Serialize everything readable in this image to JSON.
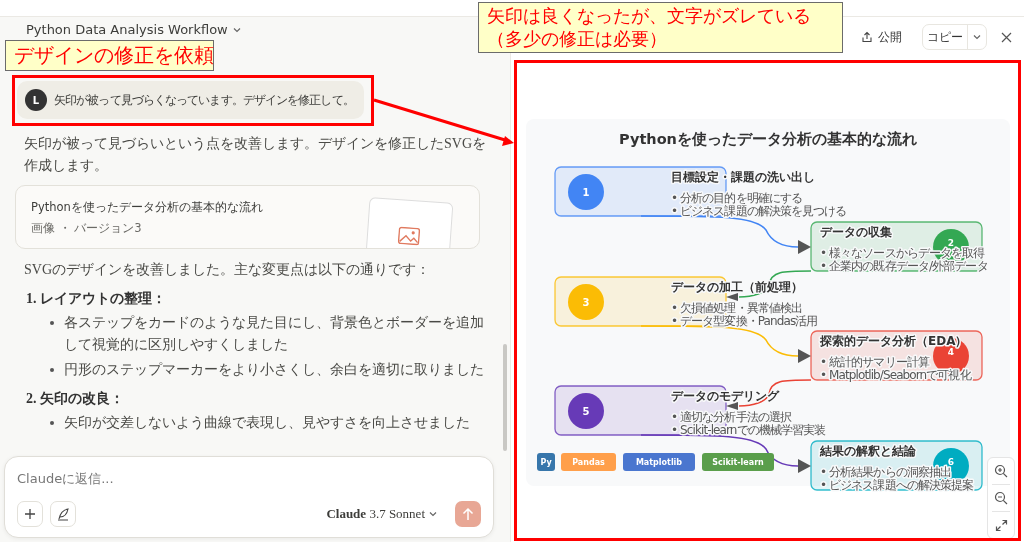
{
  "conversation": {
    "title": "Python Data Analysis Workflow"
  },
  "user_message": {
    "avatar": "L",
    "text": "矢印が被って見づらくなっています。デザインを修正して。"
  },
  "response": {
    "intro": "矢印が被って見づらいという点を改善します。デザインを修正したSVGを作成します。",
    "artifact": {
      "title": "Pythonを使ったデータ分析の基本的な流れ",
      "meta": "画像 ・ バージョン3"
    },
    "summary": "SVGのデザインを改善しました。主な変更点は以下の通りです：",
    "sections": [
      {
        "heading": "1. レイアウトの整理：",
        "bullets": [
          "各ステップをカードのような見た目にし、背景色とボーダーを追加して視覚的に区別しやすくしました",
          "円形のステップマーカーをより小さくし、余白を適切に取りました"
        ]
      },
      {
        "heading": "2. 矢印の改良：",
        "bullets": [
          "矢印が交差しないよう曲線で表現し、見やすさを向上させました"
        ]
      }
    ]
  },
  "composer": {
    "placeholder": "Claudeに返信...",
    "model": "**Claude** 3.7 Sonnet"
  },
  "artifact_panel": {
    "publish": "公開",
    "copy": "コピー",
    "diagram": {
      "title": "Pythonを使ったデータ分析の基本的な流れ",
      "steps": [
        {
          "number": "1",
          "title": "目標設定・課題の洗い出し",
          "bullets": [
            "• 分析の目的を明確にする",
            "• ビジネス課題の解決策を見つける"
          ],
          "color": "#4285f4"
        },
        {
          "number": "2",
          "title": "データの収集",
          "bullets": [
            "• 様々なソースからデータを取得",
            "• 企業内の既存データ/外部データ"
          ],
          "color": "#34a853"
        },
        {
          "number": "3",
          "title": "データの加工（前処理）",
          "bullets": [
            "• 欠損値処理・異常値検出",
            "• データ型変換・Pandas活用"
          ],
          "color": "#fbbc05"
        },
        {
          "number": "4",
          "title": "探索的データ分析（EDA）",
          "bullets": [
            "• 統計的サマリー計算",
            "• Matplotlib/Seabornで可視化"
          ],
          "color": "#ea4335"
        },
        {
          "number": "5",
          "title": "データのモデリング",
          "bullets": [
            "• 適切な分析手法の選択",
            "• Scikit-learnでの機械学習実装"
          ],
          "color": "#673ab7"
        },
        {
          "number": "6",
          "title": "結果の解釈と結論",
          "bullets": [
            "• 分析結果からの洞察抽出",
            "• ビジネス課題への解決策提案"
          ],
          "color": "#00acc1"
        }
      ],
      "libraries": [
        {
          "label": "Py",
          "color": "#3776ab"
        },
        {
          "label": "Pandas",
          "color": "#ff9f4a"
        },
        {
          "label": "Matplotlib",
          "color": "#4a76cf"
        },
        {
          "label": "Scikit-learn",
          "color": "#5a9e4b"
        }
      ]
    }
  },
  "annotations": [
    {
      "lines": [
        "デザインの修正を依頼"
      ]
    },
    {
      "lines": [
        "矢印は良くなったが、文字がズレている",
        "（多少の修正は必要）"
      ]
    }
  ]
}
